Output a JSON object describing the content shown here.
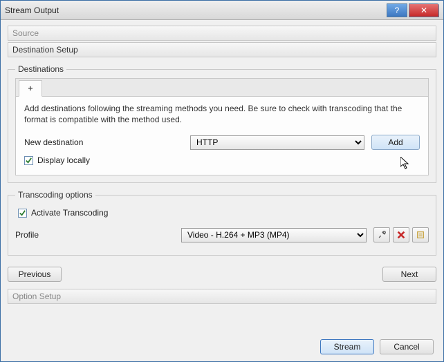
{
  "window": {
    "title": "Stream Output"
  },
  "sections": {
    "source": "Source",
    "destination_setup": "Destination Setup",
    "option_setup": "Option Setup"
  },
  "destinations": {
    "legend": "Destinations",
    "instructions": "Add destinations following the streaming methods you need. Be sure to check with transcoding that the format is compatible with the method used.",
    "new_destination_label": "New destination",
    "method_selected": "HTTP",
    "add_button": "Add",
    "display_locally_label": "Display locally",
    "display_locally_checked": true,
    "tab_plus": "+"
  },
  "transcoding": {
    "legend": "Transcoding options",
    "activate_label": "Activate Transcoding",
    "activate_checked": true,
    "profile_label": "Profile",
    "profile_selected": "Video - H.264 + MP3 (MP4)"
  },
  "nav": {
    "previous": "Previous",
    "next": "Next",
    "stream": "Stream",
    "cancel": "Cancel"
  },
  "icons": {
    "help": "?",
    "close": "✕"
  }
}
